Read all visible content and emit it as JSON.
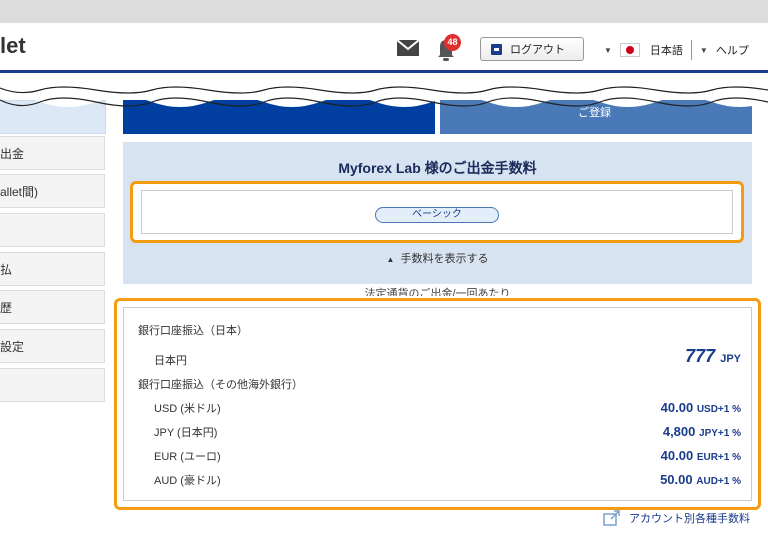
{
  "header": {
    "logo_text": "let",
    "notification_count": "48",
    "logout_label": "ログアウト",
    "language_label": "日本語",
    "help_label": "ヘルプ"
  },
  "sidebar": {
    "items": [
      {
        "label": "出金"
      },
      {
        "label": "allet間)"
      },
      {
        "label": ""
      },
      {
        "label": "払"
      },
      {
        "label": "歴"
      },
      {
        "label": "設定"
      },
      {
        "label": ""
      }
    ]
  },
  "banner": {
    "right_label": "ご登録"
  },
  "fee_panel": {
    "title": "Myforex Lab 様のご出金手数料",
    "plan_label": "ベーシック",
    "toggle_label": "手数料を表示する",
    "cut_text": "法定通貨のご出金/一回あたり"
  },
  "fee_table": {
    "domestic_header": "銀行口座振込（日本）",
    "domestic_rows": [
      {
        "label": "日本円",
        "amount": "777",
        "unit": "JPY"
      }
    ],
    "overseas_header": "銀行口座振込（その他海外銀行）",
    "overseas_rows": [
      {
        "label": "USD (米ドル)",
        "amount": "40.00",
        "unit": "USD+1 %"
      },
      {
        "label": "JPY (日本円)",
        "amount": "4,800",
        "unit": "JPY+1 %"
      },
      {
        "label": "EUR (ユーロ)",
        "amount": "40.00",
        "unit": "EUR+1 %"
      },
      {
        "label": "AUD (豪ドル)",
        "amount": "50.00",
        "unit": "AUD+1 %"
      }
    ]
  },
  "footer_link": {
    "label": "アカウント別各種手数料"
  },
  "colors": {
    "brand_navy": "#003fa0",
    "highlight_orange": "#f39c12",
    "panel_blue": "#d8e3f1",
    "badge_red": "#e03030"
  },
  "icons": [
    "mail-icon",
    "bell-icon",
    "logout-icon",
    "flag-japan-icon",
    "chevron-up-icon",
    "external-link-icon"
  ]
}
